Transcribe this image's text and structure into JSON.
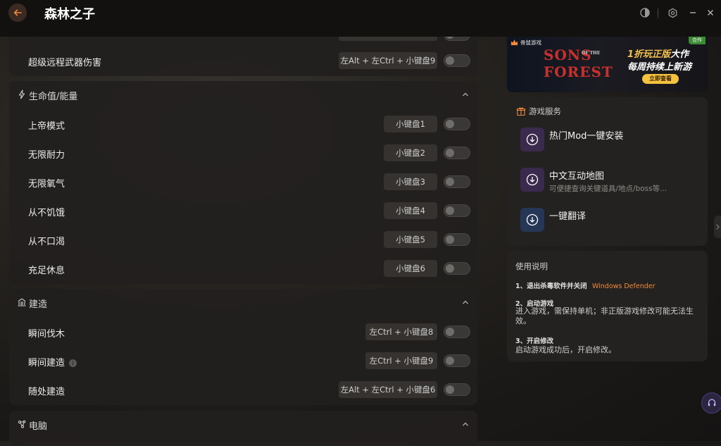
{
  "app": {
    "title": "森林之子"
  },
  "sections": {
    "ranged": {
      "rows": [
        {
          "label": "超级远程武器伤害",
          "hotkey": "左Alt + 左Ctrl + 小键盘9"
        }
      ]
    },
    "health": {
      "title": "生命值/能量",
      "rows": [
        {
          "label": "上帝模式",
          "hotkey": "小键盘1"
        },
        {
          "label": "无限耐力",
          "hotkey": "小键盘2"
        },
        {
          "label": "无限氧气",
          "hotkey": "小键盘3"
        },
        {
          "label": "从不饥饿",
          "hotkey": "小键盘4"
        },
        {
          "label": "从不口渴",
          "hotkey": "小键盘5"
        },
        {
          "label": "充足休息",
          "hotkey": "小键盘6"
        }
      ]
    },
    "build": {
      "title": "建造",
      "rows": [
        {
          "label": "瞬间伐木",
          "hotkey": "左Ctrl + 小键盘8"
        },
        {
          "label": "瞬间建造",
          "hotkey": "左Ctrl + 小键盘9",
          "info": "i"
        },
        {
          "label": "随处建造",
          "hotkey": "左Alt + 左Ctrl + 小键盘6"
        }
      ]
    },
    "computer": {
      "title": "电脑"
    }
  },
  "banner": {
    "brand": "骨鼠游戏",
    "tag": "合作",
    "game_line1": "SONS",
    "game_line2": "FOREST",
    "game_of": "OF THE",
    "promo_prefix": "1折玩",
    "promo_highlight": "正版",
    "promo_suffix": "大作",
    "promo_line2": "每周持续上新游",
    "cta": "立即查看"
  },
  "services": {
    "title": "游戏服务",
    "items": [
      {
        "title": "热门Mod一键安装",
        "subtitle": ""
      },
      {
        "title": "中文互动地图",
        "subtitle": "可便捷查询关键道具/地点/boss等..."
      },
      {
        "title": "一键翻译",
        "subtitle": ""
      }
    ]
  },
  "help": {
    "title": "使用说明",
    "step1_title": "1、退出杀毒软件并关闭",
    "step1_highlight": "Windows Defender",
    "step2_title": "2、启动游戏",
    "step2_text": "进入游戏，需保持单机；非正版游戏修改可能无法生效。",
    "step3_title": "3、开启修改",
    "step3_text": "启动游戏成功后，开启修改。"
  },
  "colors": {
    "accent": "#f08a3a",
    "highlight": "#f0883e",
    "toggle_off": "#3a3836"
  }
}
